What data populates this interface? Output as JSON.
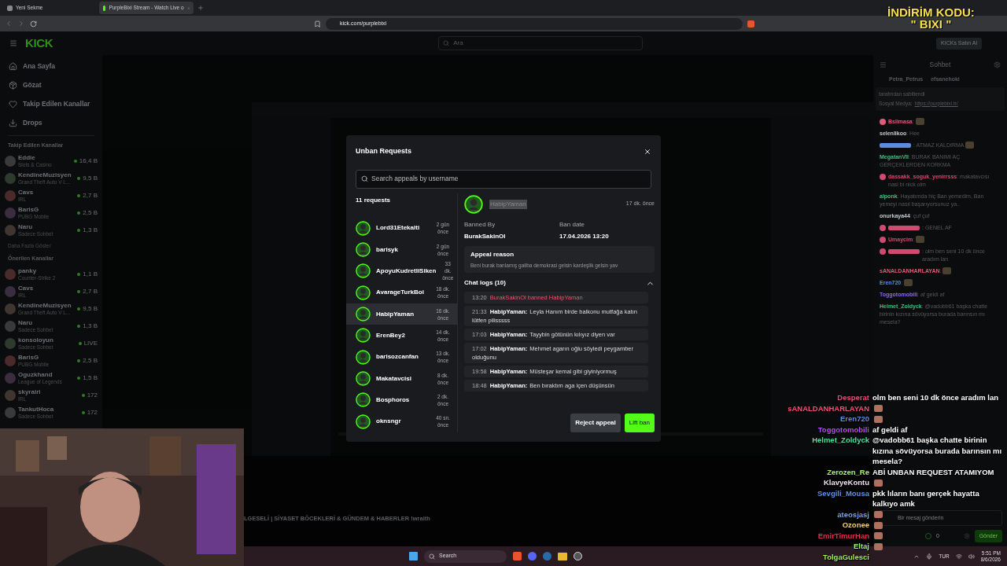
{
  "browser": {
    "tabs": [
      {
        "title": "Yeni Sekme",
        "selected": false
      },
      {
        "title": "PurpleBixi Stream - Watch Live o",
        "selected": true
      }
    ],
    "url": "kick.com/purplebixi"
  },
  "promo_overlay": {
    "line1": "İNDİRİM KODU:",
    "line2": "\" BIXI \""
  },
  "header": {
    "logo": "KICK",
    "search_placeholder": "Ara",
    "buy_button": "KICKs Satın Al"
  },
  "sidebar": {
    "nav": [
      {
        "label": "Ana Sayfa",
        "kind": "home"
      },
      {
        "label": "Gözat",
        "kind": "browse"
      },
      {
        "label": "Takip Edilen Kanallar",
        "kind": "heart"
      },
      {
        "label": "Drops",
        "kind": "drops"
      }
    ],
    "followed_title": "Takip Edilen Kanallar",
    "followed": [
      {
        "name": "Eddie",
        "category": "Slots & Casino",
        "viewers": "16,4 B"
      },
      {
        "name": "KendineMuzisyen",
        "category": "Grand Theft Auto V L...",
        "viewers": "9,5 B"
      },
      {
        "name": "Cavs",
        "category": "IRL",
        "viewers": "2,7 B"
      },
      {
        "name": "BarisG",
        "category": "PUBG Mobile",
        "viewers": "2,5 B"
      },
      {
        "name": "Naru",
        "category": "Sadece Sohbet",
        "viewers": "1,3 B"
      }
    ],
    "show_more": "Daha Fazla Göster",
    "recommended_title": "Önerilen Kanallar",
    "recommended": [
      {
        "name": "panky",
        "category": "Counter-Strike 2",
        "viewers": "1,1 B"
      },
      {
        "name": "Cavs",
        "category": "IRL",
        "viewers": "2,7 B"
      },
      {
        "name": "KendineMuzisyen",
        "category": "Grand Theft Auto V L...",
        "viewers": "9,5 B"
      },
      {
        "name": "Naru",
        "category": "Sadece Sohbet",
        "viewers": "1,3 B"
      },
      {
        "name": "konsoloyun",
        "category": "Sadece Sohbet",
        "viewers": "LIVE"
      },
      {
        "name": "BarisG",
        "category": "PUBG Mobile",
        "viewers": "2,5 B"
      },
      {
        "name": "Oguzkhand",
        "category": "League of Legends",
        "viewers": "1,5 B"
      },
      {
        "name": "skyrairi",
        "category": "IRL",
        "viewers": "172"
      },
      {
        "name": "TankutHoca",
        "category": "Sadece Sohbet",
        "viewers": "172"
      }
    ]
  },
  "stream_title": "LGESELİ | SİYASET BÖCEKLERİ & GÜNDEM & HABERLER !wraith",
  "modal": {
    "title": "Unban Requests",
    "search_placeholder": "Search appeals by username",
    "count": "11 requests",
    "requests": [
      {
        "name": "Lord31Etekalti",
        "time": "2 gün önce",
        "selected": false
      },
      {
        "name": "barisyk",
        "time": "2 gün önce",
        "selected": false
      },
      {
        "name": "ApoyuKudretliSiken",
        "time": "33 dk. önce",
        "selected": false
      },
      {
        "name": "AvarageTurkBoi",
        "time": "18 dk. önce",
        "selected": false
      },
      {
        "name": "HabipYaman",
        "time": "16 dk. önce",
        "selected": true
      },
      {
        "name": "ErenBey2",
        "time": "14 dk. önce",
        "selected": false
      },
      {
        "name": "barisozcanfan",
        "time": "13 dk. önce",
        "selected": false
      },
      {
        "name": "Makatavcisi",
        "time": "8 dk. önce",
        "selected": false
      },
      {
        "name": "Bosphoros",
        "time": "2 dk. önce",
        "selected": false
      },
      {
        "name": "oknsngr",
        "time": "40 sn. önce",
        "selected": false
      }
    ],
    "detail": {
      "name": "HabipYaman",
      "time": "17 dk. önce",
      "banned_by_label": "Banned By",
      "banned_by": "BurakSakinOl",
      "ban_date_label": "Ban date",
      "ban_date": "17.04.2026 13:20",
      "appeal_label": "Appeal reason",
      "appeal_text": "Beni burak banlamış galiba demokrasi gelsin kardeşlik gelsin yav",
      "logs_title": "Chat logs (10)",
      "logs_expanded": true,
      "logs": [
        {
          "time": "13:20",
          "kind": "ban",
          "text": "BurakSakinOl banned HabipYaman"
        },
        {
          "time": "21:33",
          "kind": "message",
          "user": "HabipYaman:",
          "text": "Leyla Hanım birde balkonu mutfağa katın lütfen pilisssss"
        },
        {
          "time": "17:03",
          "kind": "message",
          "user": "HabipYaman:",
          "text": "Tayybin götünün kılıyız diyen var"
        },
        {
          "time": "17:02",
          "kind": "message",
          "user": "HabipYaman:",
          "text": "Mehmet agarın oğlu söyledi peygamber olduğunu"
        },
        {
          "time": "19:58",
          "kind": "message",
          "user": "HabipYaman:",
          "text": "Müsteşar kemal gibi giyiniyormuş"
        },
        {
          "time": "18:48",
          "kind": "message",
          "user": "HabipYaman:",
          "text": "Ben bıraktım aga içen düşünsün"
        }
      ]
    },
    "reject_button": "Reject appeal",
    "lift_button": "Lift ban"
  },
  "chat": {
    "title": "Sohbet",
    "pinned_users": [
      "Petra_Petrus",
      "efsanehoki"
    ],
    "pinned_note": "tarafından sabitlendi",
    "pinned_prefix": "Sosyal Medya:",
    "pinned_link": "https://purplebixi.tr/",
    "messages": [
      {
        "user": "Bslimasa",
        "text": ":",
        "emote": true,
        "badge": true,
        "color": "#e05a7a"
      },
      {
        "user": "selenlikoo",
        "text": ": Hee",
        "emote": false,
        "color": "#c8c8c8"
      },
      {
        "text": ": ATMAZ KALDIRMA",
        "emote": true,
        "color": "#5b8ce0"
      },
      {
        "user": "MegatanVII",
        "text": ": BURAK BANIMI AÇ GERÇEKLERDEN KORKMA",
        "emote": false,
        "color": "#3fbf7f"
      },
      {
        "user": "dassakk_soguk_yenirrsss",
        "text": ": makatavcısı nasi bi nick olm",
        "emote": false,
        "badge": true,
        "color": "#d04a70"
      },
      {
        "user": "alponk",
        "text": ": Hayatımda hiç Ban yemedim, Ban yemeyi nasıl başarıyorsunuz ya..",
        "emote": false,
        "color": "#3fbf7f"
      },
      {
        "user": "onurkaya44",
        "text": ": çuf çuf",
        "emote": false,
        "badge": false,
        "color": "#c8c8c8"
      },
      {
        "text": ": GENEL AF",
        "emote": false,
        "badge": true,
        "color": "#d04a70"
      },
      {
        "user": "Umaycim",
        "text": ":",
        "emote": true,
        "badge": true,
        "color": "#d04a70"
      },
      {
        "text": ": olm ben seni 10 dk önce aradım lan",
        "emote": false,
        "badge": true,
        "color": "#d04a70"
      },
      {
        "user": "sANALDANHARLAYAN",
        "text": ":",
        "emote": true,
        "color": "#e05a7a"
      },
      {
        "user": "Eren720",
        "text": ":",
        "emote": true,
        "color": "#5b8ce0"
      },
      {
        "user": "Toggotomobili",
        "text": ": af geldi af",
        "emote": false,
        "color": "#8a6ae0"
      },
      {
        "user": "Helmet_Zoldyck",
        "text": ": @vadobb61 başka chatte birinin kızına sövüyorsa burada barınsın mı mesela?",
        "emote": false,
        "color": "#3fbf7f"
      }
    ],
    "input_placeholder": "Bir mesaj gönderin",
    "points": "0",
    "send_button": "Gönder"
  },
  "stream_overlay_chat": [
    {
      "user": "Desperat",
      "text": "olm ben seni 10 dk önce aradım lan",
      "emote": false,
      "color": "#e0507a"
    },
    {
      "user": "sANALDANHARLAYAN",
      "emote": true,
      "color": "#f0507a"
    },
    {
      "user": "Eren720",
      "emote": true,
      "color": "#5b8ce8"
    },
    {
      "user": "Toggotomobili",
      "text": "af geldi af",
      "emote": false,
      "color": "#b050f0"
    },
    {
      "user": "Helmet_Zoldyck",
      "text": "@vadobb61 başka chatte birinin kızına sövüyorsa burada barınsın mı mesela?",
      "emote": false,
      "color": "#50e0a0"
    },
    {
      "user": "Zerozen_Re",
      "text": "ABİ UNBAN REQUEST ATAMIYOM",
      "emote": false,
      "color": "#a0f070"
    },
    {
      "user": "KlavyeKontu",
      "emote": true,
      "color": "#f0e0f0"
    },
    {
      "user": "Sevgili_Mousa",
      "text": "pkk lıların banı gerçek hayatta kalkıyo amk",
      "emote": false,
      "color": "#6090e0"
    },
    {
      "user": "ateosjasj",
      "emote": true,
      "color": "#70a0f0"
    },
    {
      "user": "Ozonee",
      "emote": true,
      "color": "#f0d080"
    },
    {
      "user": "EmirTimurHan",
      "emote": true,
      "color": "#e03050"
    },
    {
      "user": "Eltaj",
      "emote": true,
      "color": "#a0f070"
    },
    {
      "user": "TolgaGulesci",
      "emote": false,
      "color": "#a0f050"
    }
  ],
  "taskbar": {
    "search": "Search",
    "language": "TUR",
    "time": "5:51 PM",
    "date": "8/6/2026"
  }
}
